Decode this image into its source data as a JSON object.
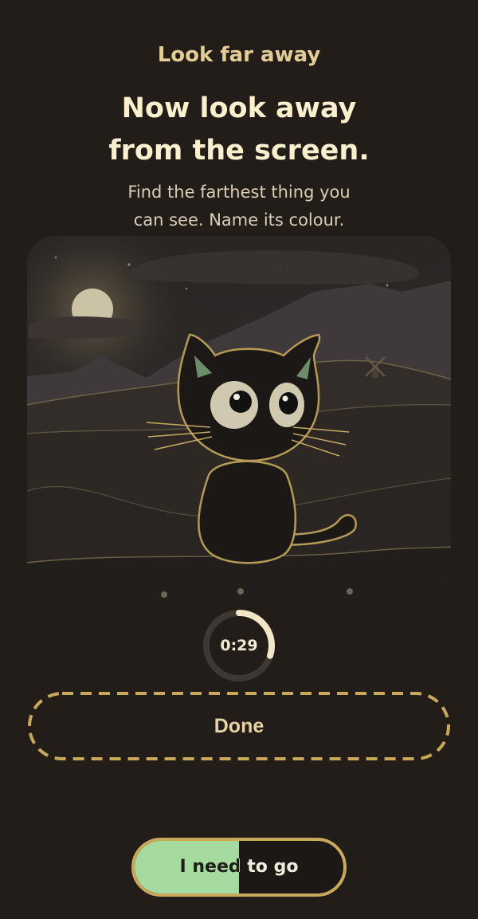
{
  "screen": {
    "eyebrow": "Look far away",
    "headline_line1": "Now look away",
    "headline_line2": "from the screen.",
    "sub_line1": "Find the farthest thing you",
    "sub_line2": "can see. Name its colour."
  },
  "illustration": {
    "icons": [
      "moon-icon",
      "windmill-icon",
      "cat-illustration"
    ]
  },
  "timer": {
    "label": "0:29",
    "remaining_fraction": 0.3,
    "color": "#f1e7c6"
  },
  "actions": {
    "done_label": "Done",
    "leave_label": "I need to go",
    "leave_hold_progress": 0.5,
    "accent": "#c9a85a",
    "leave_fill_color": "#a6dba0"
  }
}
